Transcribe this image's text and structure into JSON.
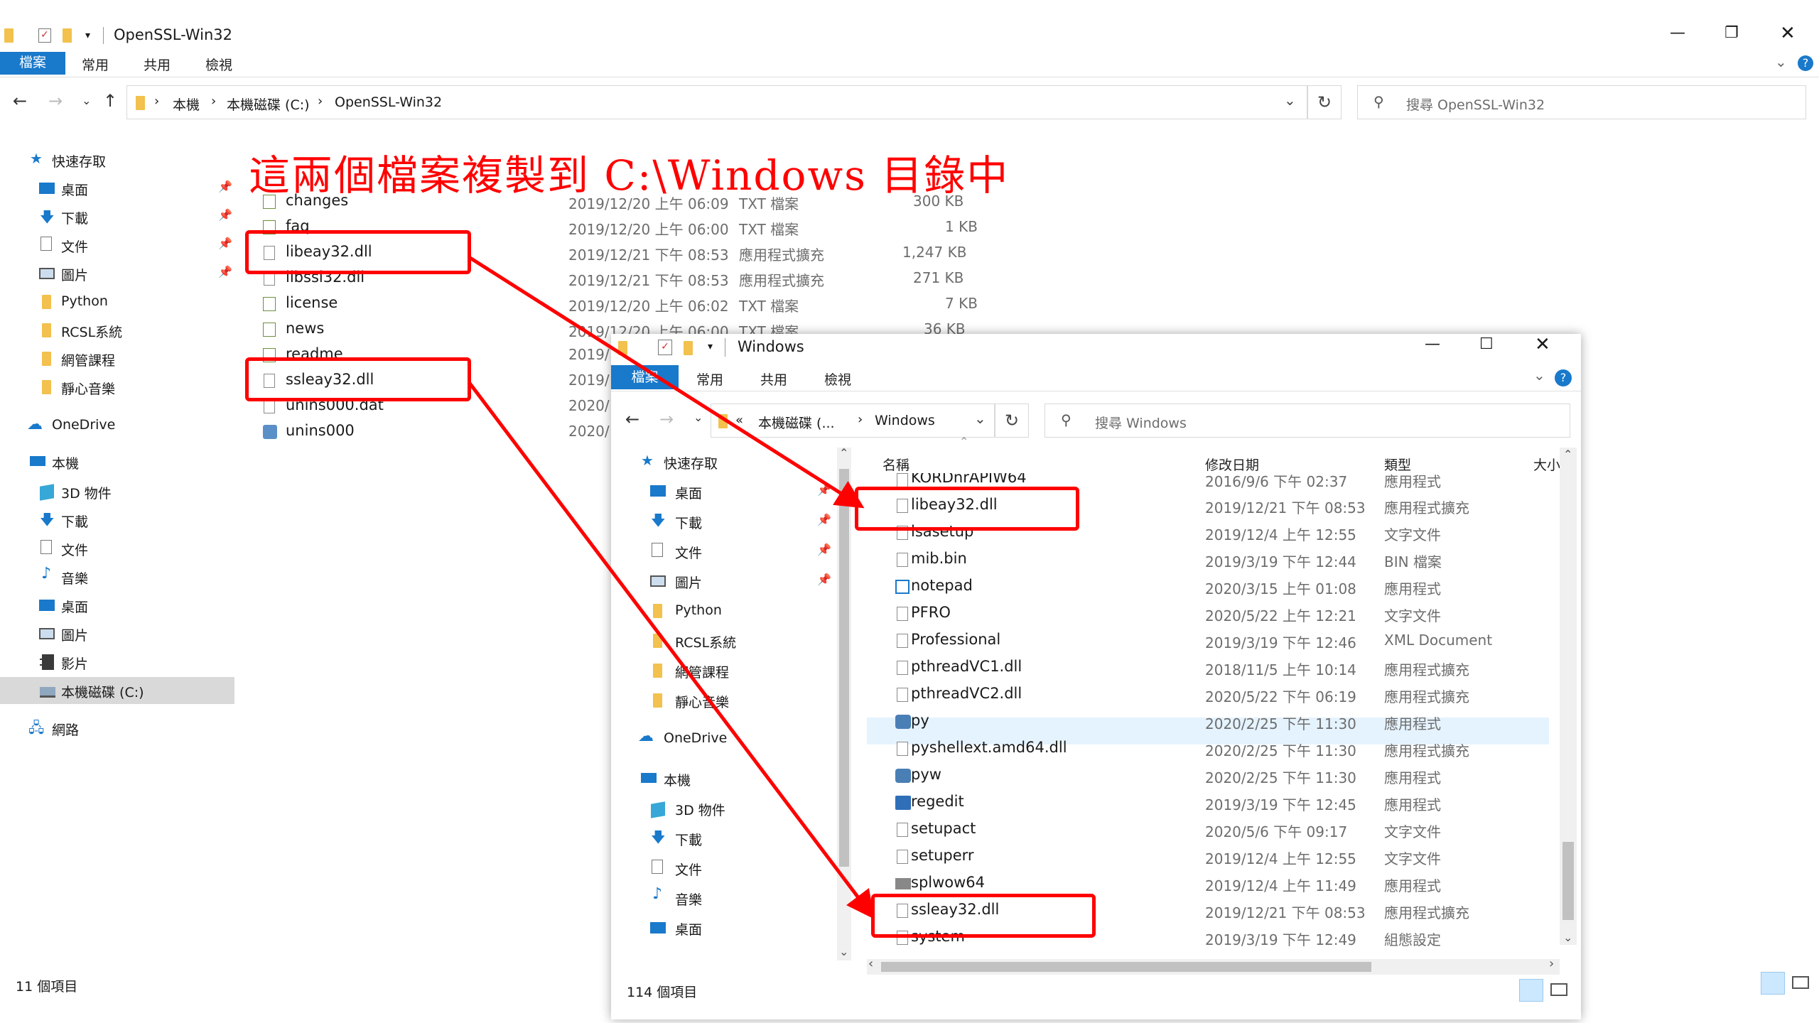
{
  "annotation": "這兩個檔案複製到 C:\\Windows 目錄中",
  "main": {
    "title": "OpenSSL-Win32",
    "ribbon_tabs": [
      "檔案",
      "常用",
      "共用",
      "檢視"
    ],
    "breadcrumb": [
      "本機",
      "本機磁碟 (C:)",
      "OpenSSL-Win32"
    ],
    "search_placeholder": "搜尋 OpenSSL-Win32",
    "status": "11 個項目",
    "nav": {
      "quick_access": "快速存取",
      "quick_items": [
        "桌面",
        "下載",
        "文件",
        "圖片",
        "Python",
        "RCSL系統",
        "網管課程",
        "靜心音樂"
      ],
      "onedrive": "OneDrive",
      "this_pc": "本機",
      "pc_items": [
        "3D 物件",
        "下載",
        "文件",
        "音樂",
        "桌面",
        "圖片",
        "影片",
        "本機磁碟 (C:)"
      ],
      "network": "網路"
    },
    "files": [
      {
        "name": "changes",
        "date": "2019/12/20 上午 06:09",
        "type": "TXT 檔案",
        "size": "300 KB"
      },
      {
        "name": "faq",
        "date": "2019/12/20 上午 06:00",
        "type": "TXT 檔案",
        "size": "1 KB"
      },
      {
        "name": "libeay32.dll",
        "date": "2019/12/21 下午 08:53",
        "type": "應用程式擴充",
        "size": "1,247 KB"
      },
      {
        "name": "libssl32.dll",
        "date": "2019/12/21 下午 08:53",
        "type": "應用程式擴充",
        "size": "271 KB"
      },
      {
        "name": "license",
        "date": "2019/12/20 上午 06:02",
        "type": "TXT 檔案",
        "size": "7 KB"
      },
      {
        "name": "news",
        "date": "2019/12/20 上午 06:00",
        "type": "TXT 檔案",
        "size": "36 KB"
      },
      {
        "name": "readme",
        "date": "2019/",
        "type": "",
        "size": ""
      },
      {
        "name": "ssleay32.dll",
        "date": "2019/",
        "type": "",
        "size": ""
      },
      {
        "name": "unins000.dat",
        "date": "2020/",
        "type": "",
        "size": ""
      },
      {
        "name": "unins000",
        "date": "2020/",
        "type": "",
        "size": ""
      }
    ]
  },
  "win2": {
    "title": "Windows",
    "ribbon_tabs": [
      "檔案",
      "常用",
      "共用",
      "檢視"
    ],
    "breadcrumb": [
      "«",
      "本機磁碟 (...",
      "Windows"
    ],
    "search_placeholder": "搜尋 Windows",
    "status": "114 個項目",
    "columns": [
      "名稱",
      "修改日期",
      "類型",
      "大小"
    ],
    "nav": {
      "quick_access": "快速存取",
      "quick_items": [
        "桌面",
        "下載",
        "文件",
        "圖片",
        "Python",
        "RCSL系統",
        "網管課程",
        "靜心音樂"
      ],
      "onedrive": "OneDrive",
      "this_pc": "本機",
      "pc_items": [
        "3D 物件",
        "下載",
        "文件",
        "音樂",
        "桌面"
      ]
    },
    "files": [
      {
        "name": "KORDnrAPIW64",
        "date": "2016/9/6 下午 02:37",
        "type": "應用程式"
      },
      {
        "name": "libeay32.dll",
        "date": "2019/12/21 下午 08:53",
        "type": "應用程式擴充"
      },
      {
        "name": "lsasetup",
        "date": "2019/12/4 上午 12:55",
        "type": "文字文件"
      },
      {
        "name": "mib.bin",
        "date": "2019/3/19 下午 12:44",
        "type": "BIN 檔案"
      },
      {
        "name": "notepad",
        "date": "2020/3/15 上午 01:08",
        "type": "應用程式"
      },
      {
        "name": "PFRO",
        "date": "2020/5/22 上午 12:21",
        "type": "文字文件"
      },
      {
        "name": "Professional",
        "date": "2019/3/19 下午 12:46",
        "type": "XML Document"
      },
      {
        "name": "pthreadVC1.dll",
        "date": "2018/11/5 上午 10:14",
        "type": "應用程式擴充"
      },
      {
        "name": "pthreadVC2.dll",
        "date": "2020/5/22 下午 06:19",
        "type": "應用程式擴充"
      },
      {
        "name": "py",
        "date": "2020/2/25 下午 11:30",
        "type": "應用程式"
      },
      {
        "name": "pyshellext.amd64.dll",
        "date": "2020/2/25 下午 11:30",
        "type": "應用程式擴充"
      },
      {
        "name": "pyw",
        "date": "2020/2/25 下午 11:30",
        "type": "應用程式"
      },
      {
        "name": "regedit",
        "date": "2019/3/19 下午 12:45",
        "type": "應用程式"
      },
      {
        "name": "setupact",
        "date": "2020/5/6 下午 09:17",
        "type": "文字文件"
      },
      {
        "name": "setuperr",
        "date": "2019/12/4 上午 12:55",
        "type": "文字文件"
      },
      {
        "name": "splwow64",
        "date": "2019/12/4 上午 11:49",
        "type": "應用程式"
      },
      {
        "name": "ssleay32.dll",
        "date": "2019/12/21 下午 08:53",
        "type": "應用程式擴充"
      },
      {
        "name": "system",
        "date": "2019/3/19 下午 12:49",
        "type": "組態設定"
      }
    ]
  }
}
